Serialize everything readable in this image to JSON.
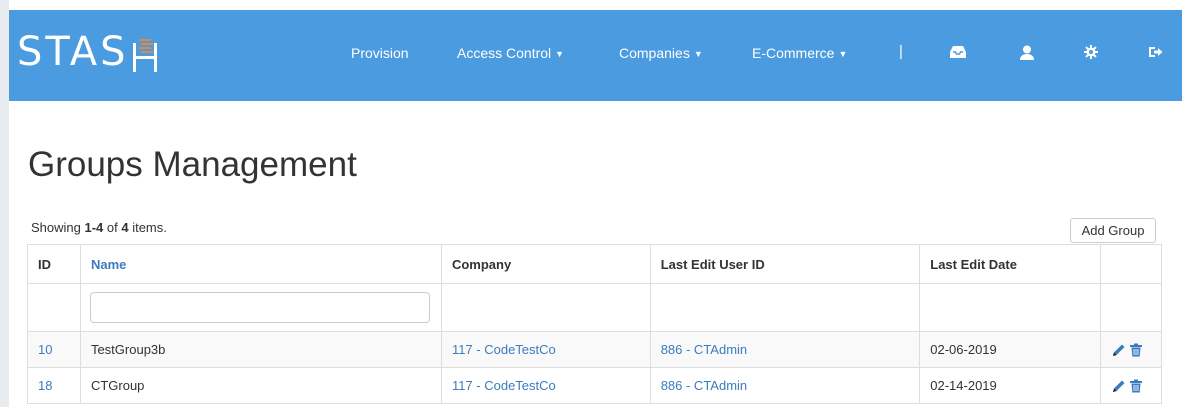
{
  "brand": {
    "text": "STAS"
  },
  "nav": {
    "items": [
      {
        "label": "Provision"
      },
      {
        "label": "Access Control"
      },
      {
        "label": "Companies"
      },
      {
        "label": "E-Commerce"
      }
    ],
    "separator": "|"
  },
  "page": {
    "title": "Groups Management",
    "summary": {
      "prefix": "Showing ",
      "range": "1-4",
      "of": " of ",
      "total": "4",
      "suffix": " items."
    },
    "add_button": "Add Group"
  },
  "table": {
    "columns": [
      "ID",
      "Name",
      "Company",
      "Last Edit User ID",
      "Last Edit Date"
    ],
    "filter": {
      "name_value": ""
    },
    "rows": [
      {
        "id": "10",
        "name": "TestGroup3b",
        "company": "117 - CodeTestCo",
        "user": "886 - CTAdmin",
        "date": "02-06-2019"
      },
      {
        "id": "18",
        "name": "CTGroup",
        "company": "117 - CodeTestCo",
        "user": "886 - CTAdmin",
        "date": "02-14-2019"
      }
    ]
  },
  "icons": {
    "inbox": "inbox-icon",
    "user": "user-icon",
    "settings": "gear-icon",
    "logout": "logout-icon",
    "edit": "pencil-icon",
    "delete": "trash-icon"
  },
  "colors": {
    "navbar": "#4a9be0",
    "link": "#3c7bc0",
    "brand_accent": "#e8873a"
  }
}
